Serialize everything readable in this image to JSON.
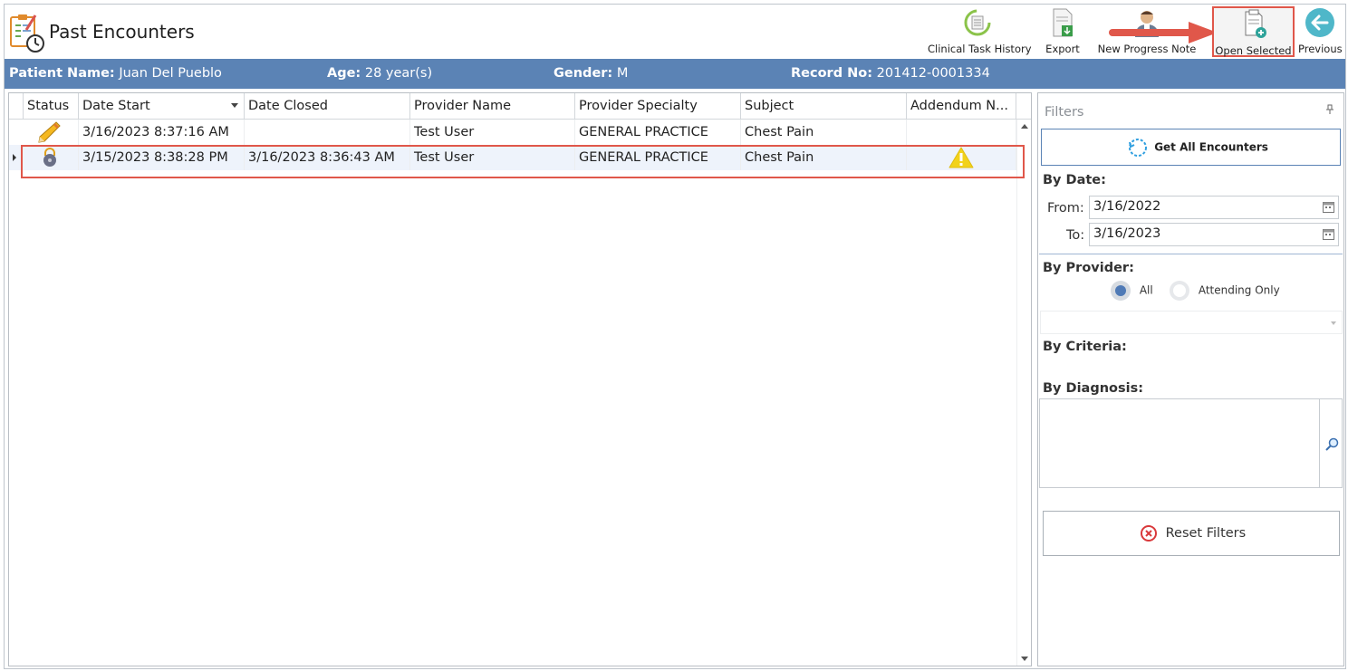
{
  "app": {
    "title": "Past Encounters"
  },
  "toolbar": {
    "clinical_task_history": "Clinical Task History",
    "export": "Export",
    "new_progress_note": "New Progress Note",
    "open_selected": "Open Selected",
    "previous": "Previous"
  },
  "patient": {
    "name_label": "Patient Name:",
    "name_value": "Juan Del Pueblo",
    "age_label": "Age:",
    "age_value": "28 year(s)",
    "gender_label": "Gender:",
    "gender_value": "M",
    "record_label": "Record No:",
    "record_value": "201412-0001334"
  },
  "grid": {
    "columns": [
      "Status",
      "Date Start",
      "Date Closed",
      "Provider Name",
      "Provider Specialty",
      "Subject",
      "Addendum N..."
    ],
    "rows": [
      {
        "status_icon": "pencil-icon",
        "date_start": "3/16/2023 8:37:16 AM",
        "date_closed": "",
        "provider_name": "Test User",
        "provider_specialty": "GENERAL PRACTICE",
        "subject": "Chest Pain",
        "addendum_icon": ""
      },
      {
        "status_icon": "lock-icon",
        "date_start": "3/15/2023 8:38:28 PM",
        "date_closed": "3/16/2023 8:36:43 AM",
        "provider_name": "Test User",
        "provider_specialty": "GENERAL PRACTICE",
        "subject": "Chest Pain",
        "addendum_icon": "warning-icon"
      }
    ],
    "selected_row": 1
  },
  "filters": {
    "title": "Filters",
    "get_all_label": "Get All Encounters",
    "by_date_label": "By Date:",
    "from_label": "From:",
    "from_value": "3/16/2022",
    "to_label": "To:",
    "to_value": "3/16/2023",
    "by_provider_label": "By Provider:",
    "provider_options": [
      "All",
      "Attending Only"
    ],
    "provider_selected": "All",
    "by_criteria_label": "By Criteria:",
    "by_diagnosis_label": "By Diagnosis:",
    "reset_label": "Reset Filters"
  },
  "colors": {
    "patient_bar": "#5b83b5",
    "highlight": "#e0574a",
    "selected_row": "#eef3fb",
    "warning": "#f2d21b",
    "previous_button": "#4fb7c9"
  }
}
